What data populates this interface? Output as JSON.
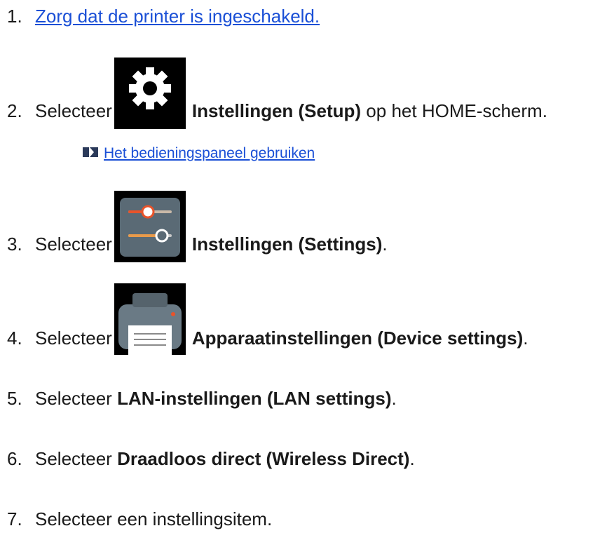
{
  "steps": [
    {
      "num": "1.",
      "link_text": "Zorg dat de printer is ingeschakeld."
    },
    {
      "num": "2.",
      "pre": "Selecteer",
      "icon": "gear-icon",
      "bold": "Instellingen (Setup)",
      "post": " op het HOME-scherm.",
      "sub_link": "Het bedieningspaneel gebruiken",
      "sub_icon": "arrow-link-icon"
    },
    {
      "num": "3.",
      "pre": "Selecteer",
      "icon": "settings-sliders-icon",
      "bold": "Instellingen (Settings)",
      "post": "."
    },
    {
      "num": "4.",
      "pre": "Selecteer",
      "icon": "printer-icon",
      "bold": "Apparaatinstellingen (Device settings)",
      "post": "."
    },
    {
      "num": "5.",
      "pre": "Selecteer ",
      "bold": "LAN-instellingen (LAN settings)",
      "post": "."
    },
    {
      "num": "6.",
      "pre": "Selecteer ",
      "bold": "Draadloos direct (Wireless Direct)",
      "post": "."
    },
    {
      "num": "7.",
      "pre": "Selecteer een instellingsitem."
    }
  ],
  "colors": {
    "link": "#1a4fd6",
    "icon_bg": "#000000",
    "settings_icon_bg": "#5a6a75",
    "accent_orange": "#e8532a",
    "printer_body": "#6a7a85"
  }
}
